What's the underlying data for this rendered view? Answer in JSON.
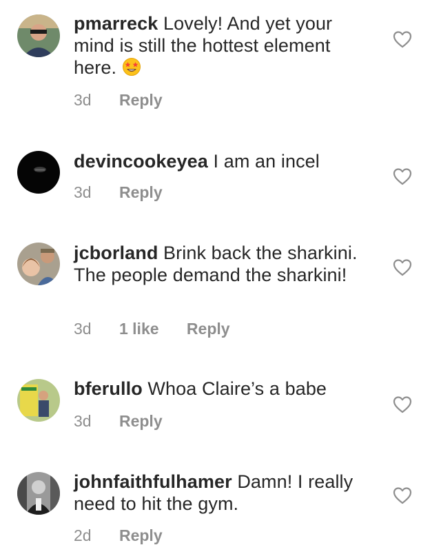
{
  "comments": [
    {
      "username": "pmarreck",
      "text": "Lovely! And yet your mind is still the hottest element here.",
      "emoji": "star-struck-emoji",
      "time": "3d",
      "likes": "",
      "reply": "Reply"
    },
    {
      "username": "devincookeyea",
      "text": "I am an incel",
      "time": "3d",
      "likes": "",
      "reply": "Reply"
    },
    {
      "username": "jcborland",
      "text": "Brink back the sharkini. The people demand the sharkini!",
      "time": "3d",
      "likes": "1 like",
      "reply": "Reply"
    },
    {
      "username": "bferullo",
      "text": "Whoa Claire’s a babe",
      "time": "3d",
      "likes": "",
      "reply": "Reply"
    },
    {
      "username": "johnfaithfulhamer",
      "text": "Damn! I really need to hit the gym.",
      "time": "2d",
      "likes": "",
      "reply": "Reply"
    }
  ],
  "icons": {
    "like": "heart-outline-icon"
  },
  "colors": {
    "text": "#262626",
    "meta": "#8e8e8e"
  }
}
